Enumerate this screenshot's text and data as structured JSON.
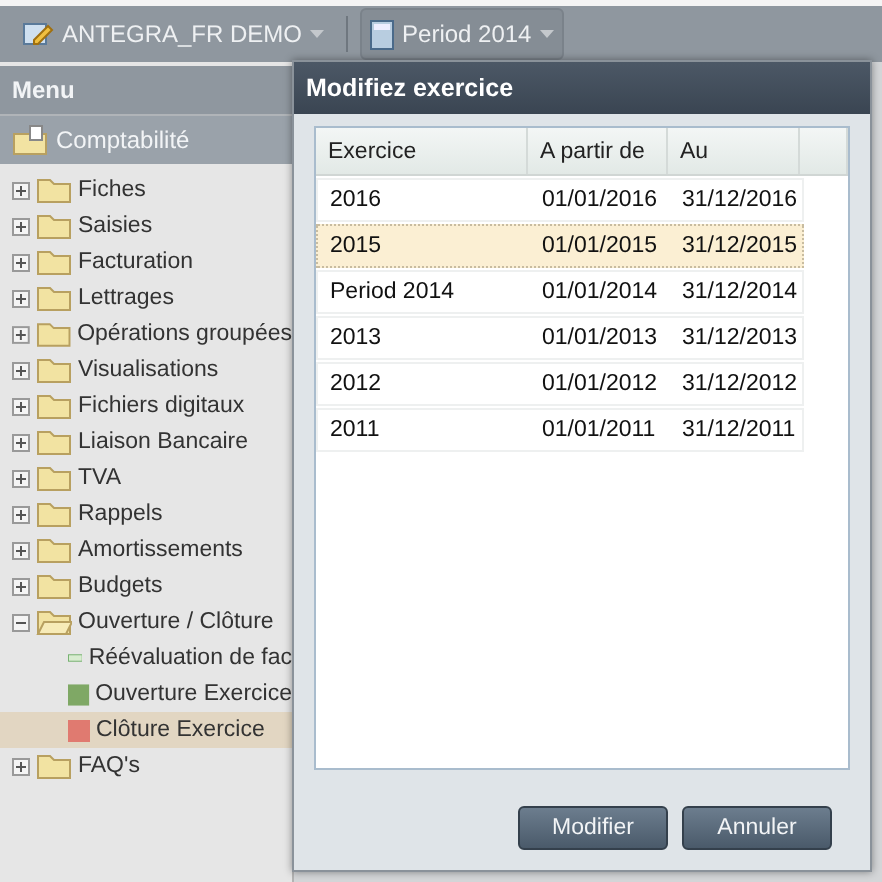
{
  "topbar": {
    "company": "ANTEGRA_FR DEMO",
    "period": "Period 2014"
  },
  "menu": {
    "title": "Menu",
    "section": "Comptabilité",
    "items": [
      {
        "label": "Fiches",
        "expanded": false
      },
      {
        "label": "Saisies",
        "expanded": false
      },
      {
        "label": "Facturation",
        "expanded": false
      },
      {
        "label": "Lettrages",
        "expanded": false
      },
      {
        "label": "Opérations groupées",
        "expanded": false
      },
      {
        "label": "Visualisations",
        "expanded": false
      },
      {
        "label": "Fichiers digitaux",
        "expanded": false
      },
      {
        "label": "Liaison Bancaire",
        "expanded": false
      },
      {
        "label": "TVA",
        "expanded": false
      },
      {
        "label": "Rappels",
        "expanded": false
      },
      {
        "label": "Amortissements",
        "expanded": false
      },
      {
        "label": "Budgets",
        "expanded": false
      },
      {
        "label": "Ouverture / Clôture",
        "expanded": true,
        "children": [
          {
            "label": "Réévaluation de fac",
            "kind": "window",
            "selected": false
          },
          {
            "label": "Ouverture Exercice",
            "kind": "square",
            "color": "#7fa865",
            "selected": false
          },
          {
            "label": "Clôture Exercice",
            "kind": "square",
            "color": "#e07a70",
            "selected": true
          }
        ]
      },
      {
        "label": "FAQ's",
        "expanded": false
      }
    ]
  },
  "dialog": {
    "title": "Modifiez exercice",
    "columns": [
      "Exercice",
      "A partir de",
      "Au"
    ],
    "rows": [
      {
        "cells": [
          "2016",
          "01/01/2016",
          "31/12/2016"
        ],
        "selected": false
      },
      {
        "cells": [
          "2015",
          "01/01/2015",
          "31/12/2015"
        ],
        "selected": true
      },
      {
        "cells": [
          "Period 2014",
          "01/01/2014",
          "31/12/2014"
        ],
        "selected": false
      },
      {
        "cells": [
          "2013",
          "01/01/2013",
          "31/12/2013"
        ],
        "selected": false
      },
      {
        "cells": [
          "2012",
          "01/01/2012",
          "31/12/2012"
        ],
        "selected": false
      },
      {
        "cells": [
          "2011",
          "01/01/2011",
          "31/12/2011"
        ],
        "selected": false
      }
    ],
    "buttons": [
      "Modifier",
      "Annuler"
    ]
  }
}
